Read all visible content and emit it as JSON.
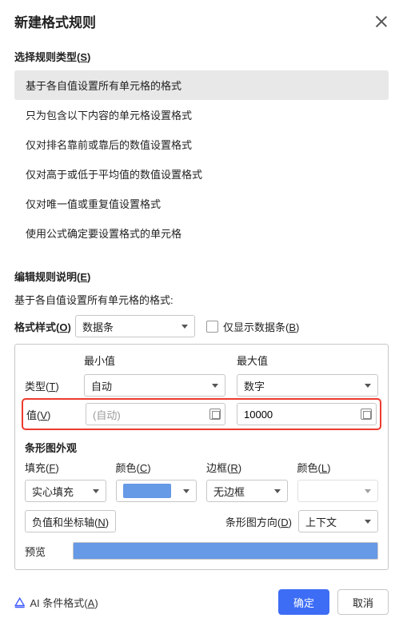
{
  "title": "新建格式规则",
  "sections": {
    "select_rule_type": {
      "label_plain": "选择规则类型",
      "label_accel": "S",
      "items": [
        "基于各自值设置所有单元格的格式",
        "只为包含以下内容的单元格设置格式",
        "仅对排名靠前或靠后的数值设置格式",
        "仅对高于或低于平均值的数值设置格式",
        "仅对唯一值或重复值设置格式",
        "使用公式确定要设置格式的单元格"
      ],
      "selected_index": 0
    },
    "edit_desc": {
      "label_plain": "编辑规则说明",
      "label_accel": "E",
      "sub": "基于各自值设置所有单元格的格式:"
    },
    "format_style": {
      "label_plain": "格式样式",
      "label_accel": "O",
      "value": "数据条",
      "show_bar_only": {
        "label_plain": "仅显示数据条",
        "label_accel": "B",
        "checked": false
      }
    },
    "minmax": {
      "min_header": "最小值",
      "max_header": "最大值",
      "type_label_plain": "类型",
      "type_label_accel": "T",
      "min_type": "自动",
      "max_type": "数字",
      "value_label_plain": "值",
      "value_label_accel": "V",
      "min_value_placeholder": "(自动)",
      "max_value": "10000"
    },
    "bar_appearance": {
      "header": "条形图外观",
      "fill": {
        "label_plain": "填充",
        "label_accel": "F",
        "value": "实心填充"
      },
      "color1": {
        "label_plain": "颜色",
        "label_accel": "C",
        "value": "#6699e6"
      },
      "border": {
        "label_plain": "边框",
        "label_accel": "R",
        "value": "无边框"
      },
      "color2": {
        "label_plain": "颜色",
        "label_accel": "L"
      },
      "neg_axis": {
        "label_plain": "负值和坐标轴",
        "label_accel": "N"
      },
      "direction": {
        "label_plain": "条形图方向",
        "label_accel": "D",
        "value": "上下文"
      },
      "preview_label": "预览"
    }
  },
  "footer": {
    "ai_label_plain": "AI 条件格式",
    "ai_accel": "A",
    "ok": "确定",
    "cancel": "取消"
  }
}
